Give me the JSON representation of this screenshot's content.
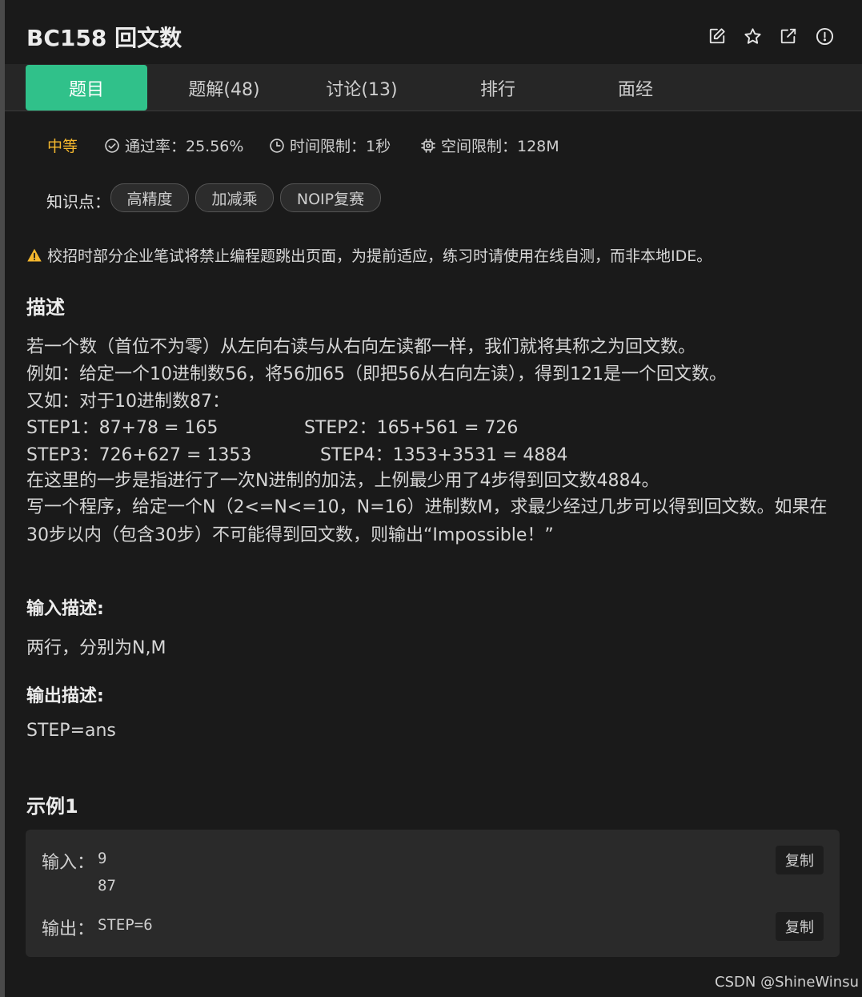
{
  "problem": {
    "title": "BC158  回文数"
  },
  "tabs": [
    {
      "label": "题目"
    },
    {
      "label": "题解(48)"
    },
    {
      "label": "讨论(13)"
    },
    {
      "label": "排行"
    },
    {
      "label": "面经"
    }
  ],
  "meta": {
    "difficulty": "中等",
    "pass_rate": "通过率：25.56%",
    "time_limit": "时间限制：1秒",
    "space_limit": "空间限制：128M"
  },
  "knowledge": {
    "label": "知识点：",
    "tags": [
      "高精度",
      "加减乘",
      "NOIP复赛"
    ]
  },
  "warning": "校招时部分企业笔试将禁止编程题跳出页面，为提前适应，练习时请使用在线自测，而非本地IDE。",
  "description": {
    "title": "描述",
    "line1": "若一个数（首位不为零）从左向右读与从右向左读都一样，我们就将其称之为回文数。",
    "line2": "例如：给定一个10进制数56，将56加65（即把56从右向左读），得到121是一个回文数。",
    "line3": "又如：对于10进制数87：",
    "step1": "STEP1：87+78  = 165",
    "step2": "STEP2：165+561 = 726",
    "step3": "STEP3：726+627 = 1353",
    "step4": "STEP4：1353+3531 = 4884",
    "line5": "在这里的一步是指进行了一次N进制的加法，上例最少用了4步得到回文数4884。",
    "line6": "写一个程序，给定一个N（2<=N<=10，N=16）进制数M，求最少经过几步可以得到回文数。如果在",
    "line7": "30步以内（包含30步）不可能得到回文数，则输出“Impossible！”"
  },
  "input_desc": {
    "title": "输入描述:",
    "text": "两行，分别为N,M"
  },
  "output_desc": {
    "title": "输出描述:",
    "text": "STEP=ans"
  },
  "example": {
    "title": "示例1",
    "input_label": "输入：",
    "input_line1": "9",
    "input_line2": "87",
    "output_label": "输出：",
    "output_value": "STEP=6",
    "copy_label": "复制"
  },
  "watermark": "CSDN @ShineWinsu",
  "colors": {
    "accent": "#30c18a",
    "difficulty": "#f5b82e",
    "warning": "#f5b82e",
    "background": "#1a1a1a"
  },
  "icons": [
    "edit-icon",
    "star-icon",
    "share-icon",
    "report-icon",
    "check-circle-icon",
    "clock-icon",
    "chip-icon",
    "warning-icon"
  ]
}
